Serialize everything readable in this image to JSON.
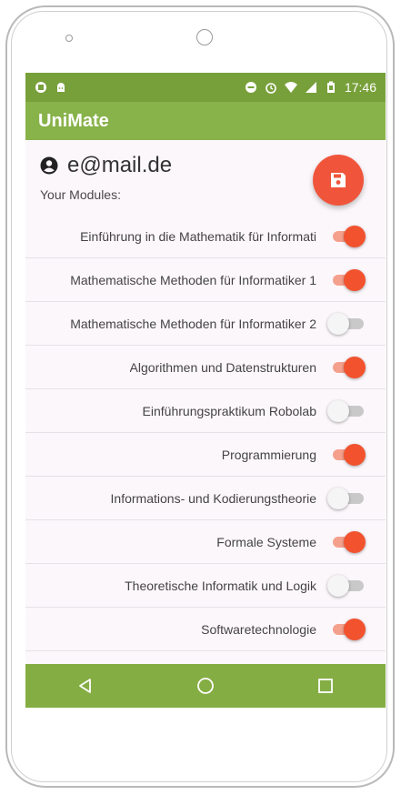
{
  "status_bar": {
    "time": "17:46",
    "left_icons": [
      "notification-icon",
      "android-icon"
    ],
    "right_icons": [
      "do-not-disturb-icon",
      "alarm-icon",
      "wifi-icon",
      "signal-icon",
      "battery-icon"
    ]
  },
  "app": {
    "title": "UniMate",
    "primary_color": "#88b24a",
    "accent_color": "#f2522d"
  },
  "user": {
    "email": "e@mail.de",
    "icon": "account-icon"
  },
  "modules_label": "Your Modules:",
  "fab": {
    "icon": "save-icon"
  },
  "modules": [
    {
      "name": "Einführung in die Mathematik für Informati",
      "enabled": true
    },
    {
      "name": "Mathematische Methoden für Informatiker 1",
      "enabled": true
    },
    {
      "name": "Mathematische Methoden für Informatiker 2",
      "enabled": false
    },
    {
      "name": "Algorithmen und Datenstrukturen",
      "enabled": true
    },
    {
      "name": "Einführungspraktikum Robolab",
      "enabled": false
    },
    {
      "name": "Programmierung",
      "enabled": true
    },
    {
      "name": "Informations- und Kodierungstheorie",
      "enabled": false
    },
    {
      "name": "Formale Systeme",
      "enabled": true
    },
    {
      "name": "Theoretische Informatik und Logik",
      "enabled": false
    },
    {
      "name": "Softwaretechnologie",
      "enabled": true
    }
  ],
  "nav": [
    "back-icon",
    "home-icon",
    "recents-icon"
  ]
}
